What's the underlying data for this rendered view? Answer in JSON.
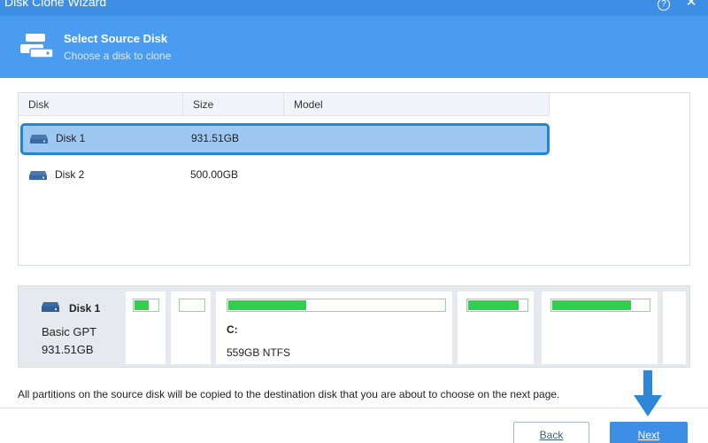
{
  "window": {
    "title": "Disk Clone Wizard"
  },
  "header": {
    "title": "Select Source Disk",
    "subtitle": "Choose a disk to clone"
  },
  "table": {
    "columns": [
      "Disk",
      "Size",
      "Model"
    ],
    "rows": [
      {
        "name": "Disk 1",
        "size": "931.51GB",
        "model": ""
      },
      {
        "name": "Disk 2",
        "size": "500.00GB",
        "model": ""
      }
    ]
  },
  "disk_map": {
    "name": "Disk 1",
    "type": "Basic GPT",
    "capacity": "931.51GB",
    "partitions": [
      {
        "letter": "",
        "size": "",
        "used_fraction": 0.6
      },
      {
        "letter": "",
        "size": "",
        "used_fraction": 0.0
      },
      {
        "letter": "C:",
        "size": "559GB NTFS",
        "used_fraction": 0.36
      },
      {
        "letter": "",
        "size": "",
        "used_fraction": 0.86
      },
      {
        "letter": "",
        "size": "",
        "used_fraction": 0.82
      }
    ]
  },
  "footer": {
    "note": "All partitions on the source disk will be copied to the destination disk that you are about to choose on the next page.",
    "back_label": "Back",
    "next_label": "Next"
  },
  "colors": {
    "titlebar": "#3d8fe6",
    "header": "#4a9cf0",
    "selection": "#9dc8f2",
    "selection_border": "#1f87d6",
    "partition_fill": "#2fd04c",
    "arrow": "#2e86d9"
  }
}
